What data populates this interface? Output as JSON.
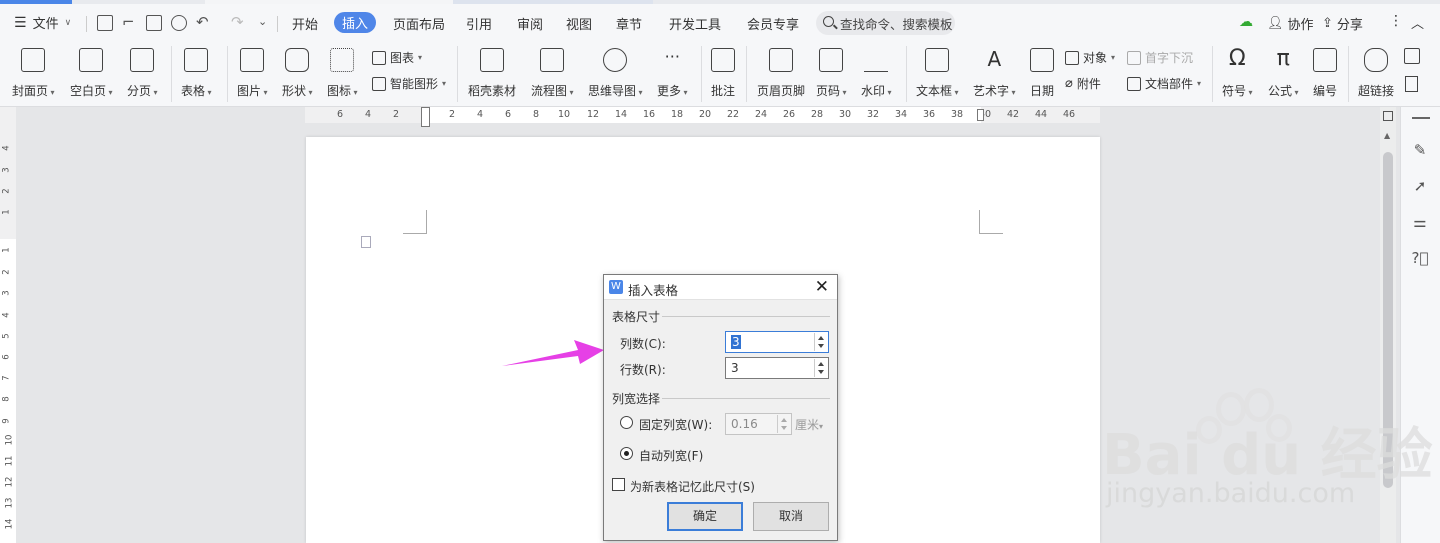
{
  "menubar": {
    "file_label": "文件",
    "tabs": [
      "开始",
      "插入",
      "页面布局",
      "引用",
      "审阅",
      "视图",
      "章节",
      "开发工具",
      "会员专享"
    ],
    "active_tab": "插入",
    "search_placeholder": "查找命令、搜索模板",
    "collab_label": "协作",
    "share_label": "分享"
  },
  "ribbon": {
    "cover_page": "封面页",
    "blank_page": "空白页",
    "page_break": "分页",
    "table": "表格",
    "picture": "图片",
    "shape": "形状",
    "icon": "图标",
    "chart": "图表",
    "smart_shape": "智能图形",
    "material": "稻壳素材",
    "flowchart": "流程图",
    "mindmap": "思维导图",
    "more": "更多",
    "comment": "批注",
    "header_footer": "页眉页脚",
    "page_number": "页码",
    "watermark": "水印",
    "textbox": "文本框",
    "wordart": "艺术字",
    "date": "日期",
    "object": "对象",
    "attachment": "附件",
    "drop_cap": "首字下沉",
    "doc_parts": "文档部件",
    "symbol": "符号",
    "formula": "公式",
    "numbering": "编号",
    "hyperlink": "超链接"
  },
  "ruler": {
    "h_ticks": [
      "6",
      "4",
      "2",
      "2",
      "4",
      "6",
      "8",
      "10",
      "12",
      "14",
      "16",
      "18",
      "20",
      "22",
      "24",
      "26",
      "28",
      "30",
      "32",
      "34",
      "36",
      "38",
      "40",
      "42",
      "44",
      "46"
    ],
    "v_ticks_top": [
      "4",
      "3",
      "2",
      "1"
    ],
    "v_ticks": [
      "1",
      "2",
      "3",
      "4",
      "5",
      "6",
      "7",
      "8",
      "9",
      "10",
      "11",
      "12",
      "13",
      "14"
    ]
  },
  "dialog": {
    "title": "插入表格",
    "group_size": "表格尺寸",
    "columns_label": "列数(C):",
    "columns_value": "3",
    "rows_label": "行数(R):",
    "rows_value": "3",
    "group_width": "列宽选择",
    "fixed_width_label": "固定列宽(W):",
    "fixed_width_value": "0.16",
    "fixed_width_unit": "厘米",
    "auto_width_label": "自动列宽(F)",
    "remember_label": "为新表格记忆此尺寸(S)",
    "ok_label": "确定",
    "cancel_label": "取消",
    "selected_width_mode": "auto"
  },
  "watermark": {
    "brand": "Bai  du 经验",
    "url": "jingyan.baidu.com"
  },
  "colors": {
    "accent": "#4f86e8",
    "arrow": "#e640e6"
  }
}
